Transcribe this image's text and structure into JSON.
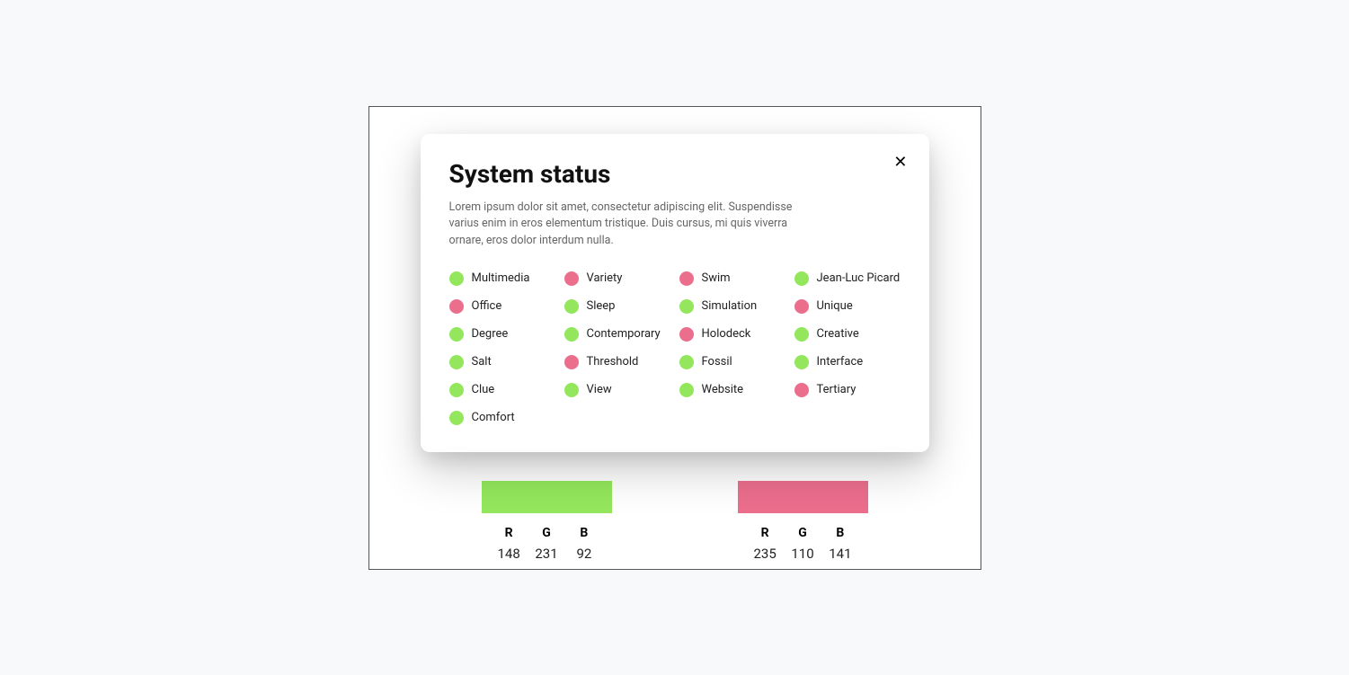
{
  "dialog": {
    "title": "System status",
    "description": "Lorem ipsum dolor sit amet, consectetur adipiscing elit. Suspendisse varius enim in eros elementum tristique. Duis cursus, mi quis viverra ornare, eros dolor interdum nulla."
  },
  "colors": {
    "green": "#94E75C",
    "red": "#EB6E8D"
  },
  "columns": [
    [
      {
        "label": "Multimedia",
        "status": "green"
      },
      {
        "label": "Office",
        "status": "red"
      },
      {
        "label": "Degree",
        "status": "green"
      },
      {
        "label": "Salt",
        "status": "green"
      },
      {
        "label": "Clue",
        "status": "green"
      },
      {
        "label": "Comfort",
        "status": "green"
      }
    ],
    [
      {
        "label": "Variety",
        "status": "red"
      },
      {
        "label": "Sleep",
        "status": "green"
      },
      {
        "label": "Contemporary",
        "status": "green"
      },
      {
        "label": "Threshold",
        "status": "red"
      },
      {
        "label": "View",
        "status": "green"
      }
    ],
    [
      {
        "label": "Swim",
        "status": "red"
      },
      {
        "label": "Simulation",
        "status": "green"
      },
      {
        "label": "Holodeck",
        "status": "red"
      },
      {
        "label": "Fossil",
        "status": "green"
      },
      {
        "label": "Website",
        "status": "green"
      }
    ],
    [
      {
        "label": "Jean-Luc Picard",
        "status": "green"
      },
      {
        "label": "Unique",
        "status": "red"
      },
      {
        "label": "Creative",
        "status": "green"
      },
      {
        "label": "Interface",
        "status": "green"
      },
      {
        "label": "Tertiary",
        "status": "red"
      }
    ]
  ],
  "swatches": [
    {
      "color": "#94E75C",
      "label": {
        "r": "R",
        "g": "G",
        "b": "B"
      },
      "rgb": {
        "r": "148",
        "g": "231",
        "b": "92"
      }
    },
    {
      "color": "#EB6E8D",
      "label": {
        "r": "R",
        "g": "G",
        "b": "B"
      },
      "rgb": {
        "r": "235",
        "g": "110",
        "b": "141"
      }
    }
  ]
}
